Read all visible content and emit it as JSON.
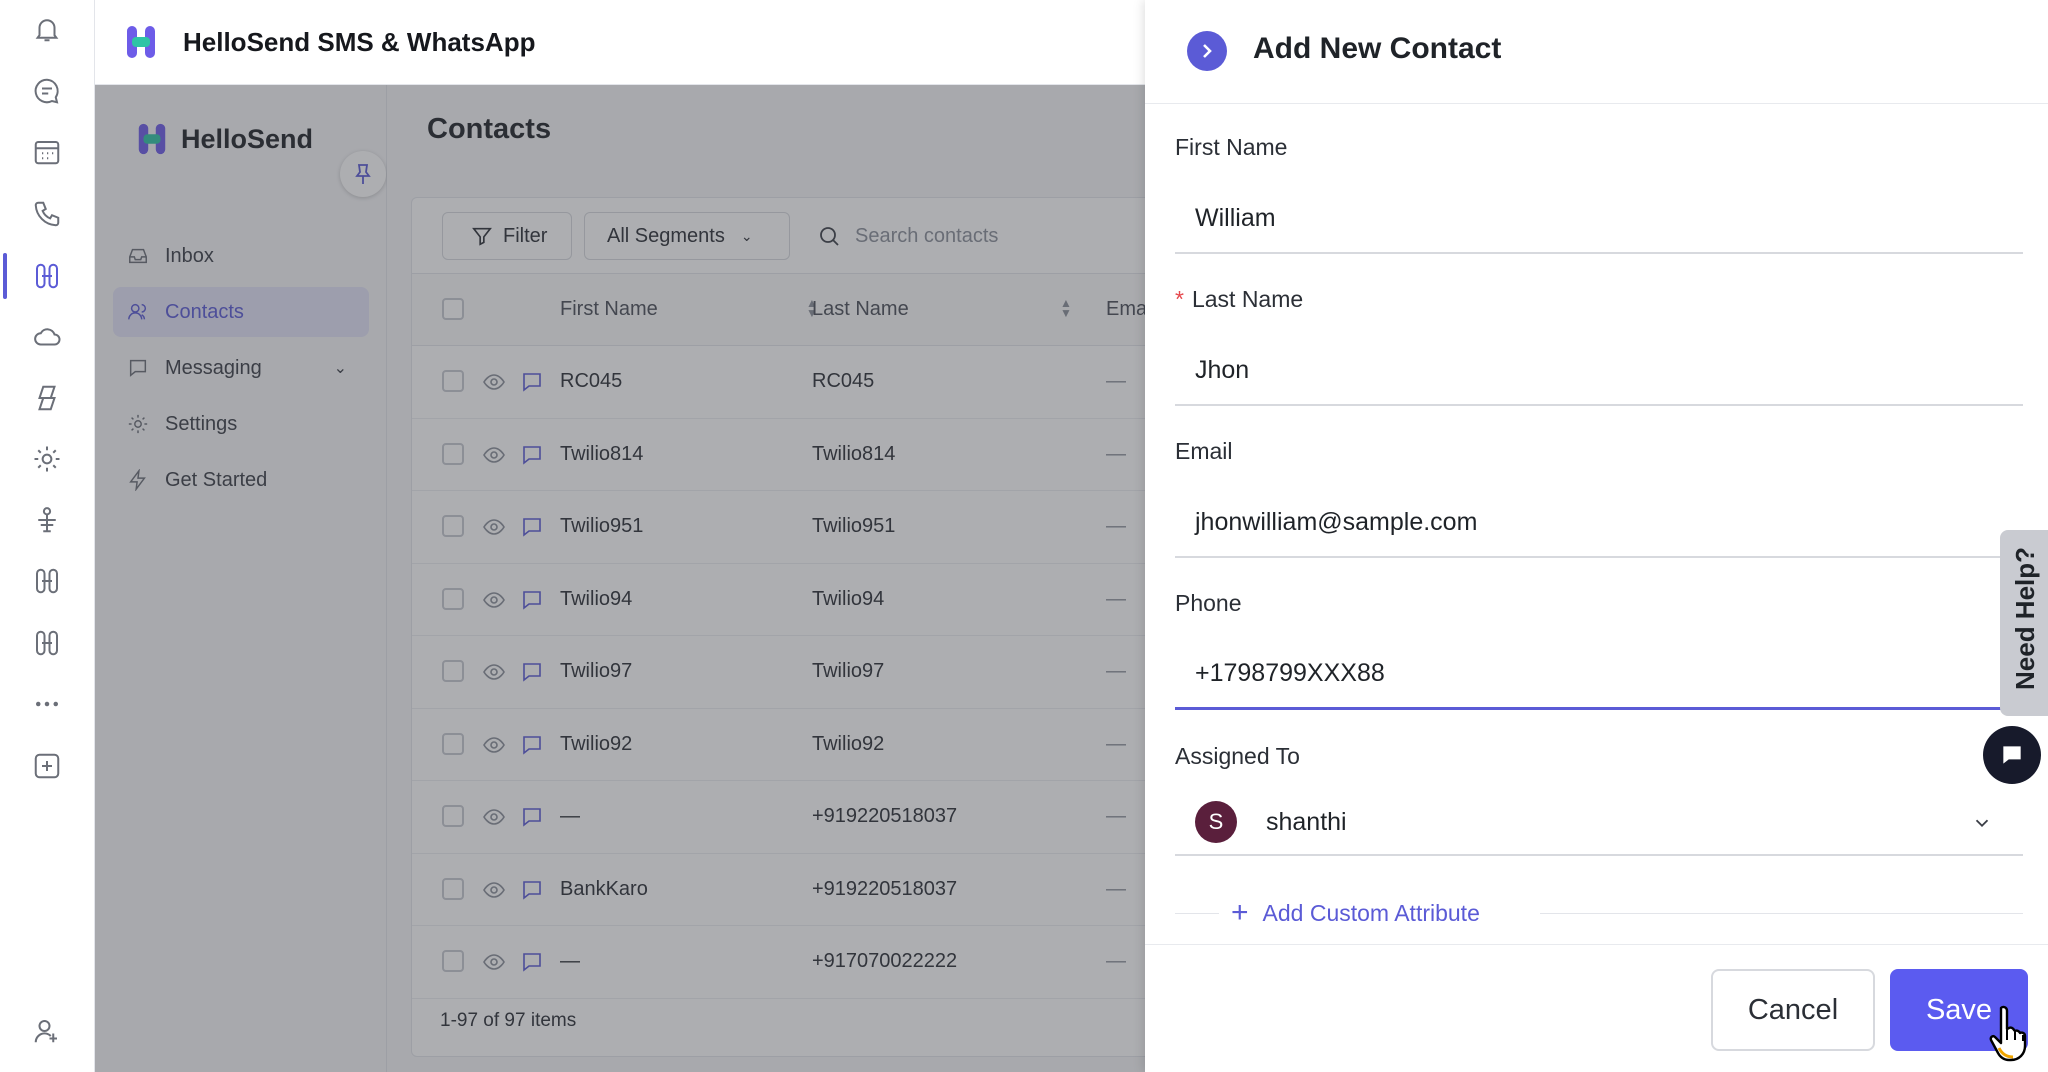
{
  "app": {
    "title": "HelloSend SMS & WhatsApp"
  },
  "rail": {
    "icons": [
      "bell-icon",
      "chat-bubble-icon",
      "calendar-icon",
      "phone-icon",
      "hellosend-app-icon",
      "cloud-icon",
      "copilot-icon",
      "settings-gear-icon",
      "tree-icon",
      "app-tile-icon",
      "app-tile-icon",
      "more-icon",
      "add-app-icon",
      "profile-icon"
    ],
    "active_color": "#5b5bd6"
  },
  "sidebar": {
    "brand": "HelloSend",
    "items": [
      {
        "label": "Inbox",
        "icon": "inbox-icon"
      },
      {
        "label": "Contacts",
        "icon": "contacts-icon",
        "active": true
      },
      {
        "label": "Messaging",
        "icon": "message-icon",
        "expandable": true
      },
      {
        "label": "Settings",
        "icon": "gear-icon"
      },
      {
        "label": "Get Started",
        "icon": "bolt-icon"
      }
    ]
  },
  "contacts": {
    "title": "Contacts",
    "filter_label": "Filter",
    "segment_label": "All Segments",
    "search_placeholder": "Search contacts",
    "columns": {
      "first_name": "First Name",
      "last_name": "Last Name",
      "email": "Ema"
    },
    "rows": [
      {
        "first": "RC045",
        "last": "RC045",
        "email": "—"
      },
      {
        "first": "Twilio814",
        "last": "Twilio814",
        "email": "—"
      },
      {
        "first": "Twilio951",
        "last": "Twilio951",
        "email": "—"
      },
      {
        "first": "Twilio94",
        "last": "Twilio94",
        "email": "—"
      },
      {
        "first": "Twilio97",
        "last": "Twilio97",
        "email": "—"
      },
      {
        "first": "Twilio92",
        "last": "Twilio92",
        "email": "—"
      },
      {
        "first": "—",
        "last": "+919220518037",
        "email": "—"
      },
      {
        "first": "BankKaro",
        "last": "+919220518037",
        "email": "—"
      },
      {
        "first": "—",
        "last": "+917070022222",
        "email": "—"
      }
    ],
    "footer": "1-97 of 97 items"
  },
  "drawer": {
    "title": "Add New Contact",
    "first_name": {
      "label": "First Name",
      "value": "William"
    },
    "last_name": {
      "label": "Last Name",
      "required": "*",
      "value": "Jhon"
    },
    "email": {
      "label": "Email",
      "value": "jhonwilliam@sample.com"
    },
    "phone": {
      "label": "Phone",
      "value": "+1798799XXX88"
    },
    "assigned": {
      "label": "Assigned To",
      "avatar_initial": "S",
      "name": "shanthi",
      "avatar_color": "#5a1f3c"
    },
    "add_custom": "Add Custom Attribute",
    "cancel": "Cancel",
    "save": "Save",
    "accent": "#5b5bf0"
  },
  "help": {
    "label": "Need Help?"
  }
}
